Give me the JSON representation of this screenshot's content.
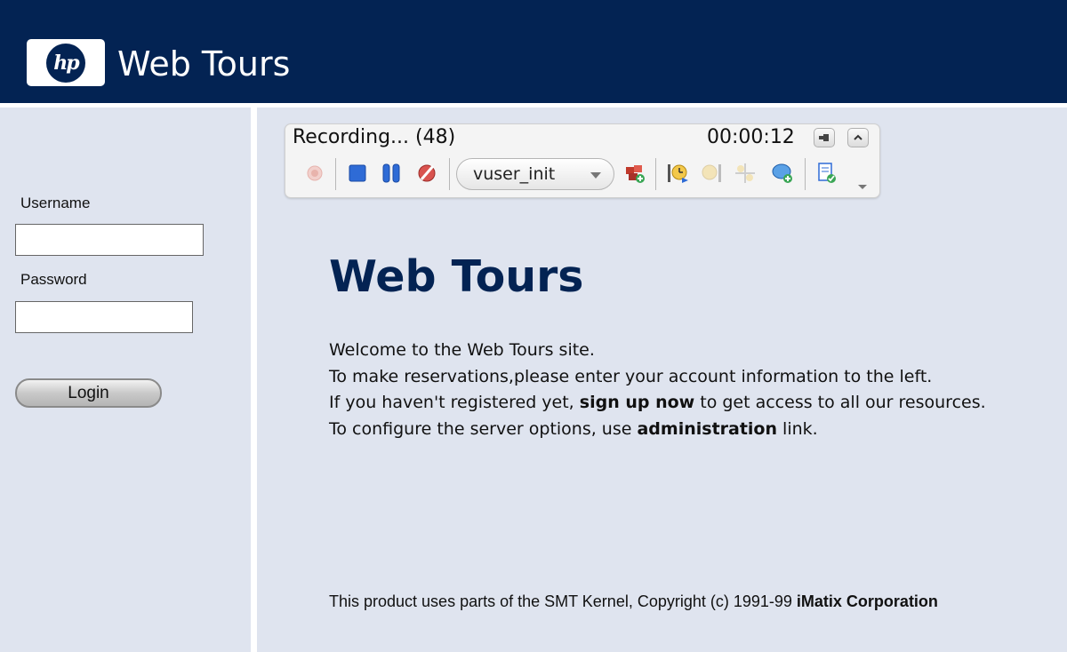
{
  "header": {
    "logo_text": "hp",
    "brand": "Web Tours"
  },
  "login": {
    "username_label": "Username",
    "username_value": "",
    "password_label": "Password",
    "password_value": "",
    "login_button": "Login"
  },
  "recorder": {
    "status": "Recording... (48)",
    "elapsed": "00:00:12",
    "action_select": "vuser_init",
    "icons": [
      "record-icon",
      "stop-icon",
      "pause-icon",
      "cancel-recording-icon",
      "insert-action-icon",
      "start-transaction-icon",
      "end-transaction-icon",
      "insert-rendezvous-icon",
      "insert-comment-icon",
      "create-checkpoint-icon"
    ]
  },
  "content": {
    "title": "Web Tours",
    "line1": "Welcome to the Web Tours site.",
    "line2": "To make reservations,please enter your account information to the left.",
    "line3_pre": "If you haven't registered yet, ",
    "line3_link": "sign up now",
    "line3_post": " to get access to all our resources.",
    "line4_pre": "To configure the server options, use ",
    "line4_link": "administration",
    "line4_post": " link."
  },
  "footer": {
    "text": "This product uses parts of the SMT Kernel, Copyright (c) 1991-99 ",
    "company": "iMatix Corporation"
  },
  "colors": {
    "header_bg": "#032353",
    "pane_bg": "#dfe4ef",
    "title": "#032353"
  }
}
